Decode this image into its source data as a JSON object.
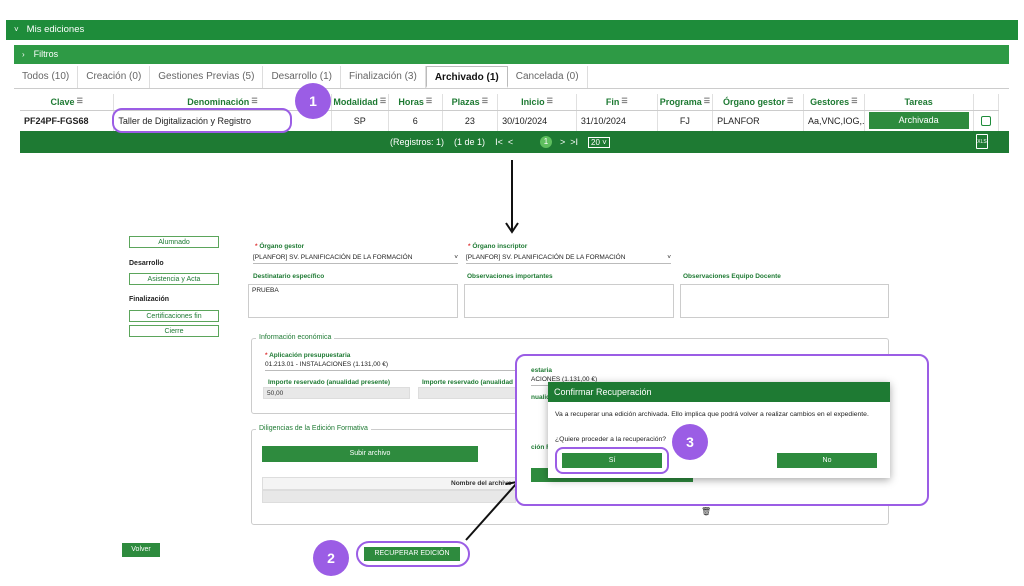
{
  "header": {
    "title": "Mis ediciones",
    "filters_label": "Filtros"
  },
  "tabs": [
    {
      "label": "Todos (10)"
    },
    {
      "label": "Creación (0)"
    },
    {
      "label": "Gestiones Previas (5)"
    },
    {
      "label": "Desarrollo (1)"
    },
    {
      "label": "Finalización (3)"
    },
    {
      "label": "Archivado (1)"
    },
    {
      "label": "Cancelada (0)"
    }
  ],
  "table": {
    "columns": [
      "Clave",
      "Denominación",
      "Modalidad",
      "Horas",
      "Plazas",
      "Inicio",
      "Fin",
      "Programa",
      "Órgano gestor",
      "Gestores",
      "Tareas"
    ],
    "row": {
      "clave": "PF24PF-FGS68",
      "denominacion": "Taller de Digitalización y Registro",
      "modalidad": "SP",
      "horas": "6",
      "plazas": "23",
      "inicio": "30/10/2024",
      "fin": "31/10/2024",
      "programa": "FJ",
      "organo": "PLANFOR",
      "gestores": "Aa,VNC,IOG,...",
      "tarea": "Archivada"
    }
  },
  "pager": {
    "info": "(Registros: 1)",
    "pages": "(1 de 1)",
    "current": "1",
    "size": "20"
  },
  "annotations": {
    "step1": "1",
    "step2": "2",
    "step3": "3"
  },
  "form": {
    "sidebar": {
      "alumnado": "Alumnado",
      "desarrollo_head": "Desarrollo",
      "asistencia": "Asistencia y Acta",
      "finalizacion_head": "Finalización",
      "certificaciones": "Certificaciones fin",
      "cierre": "Cierre"
    },
    "organo_gestor_label": "Órgano gestor",
    "organo_gestor_value": "[PLANFOR] SV. PLANIFICACIÓN DE LA FORMACIÓN",
    "organo_inscriptor_label": "Órgano inscriptor",
    "organo_inscriptor_value": "[PLANFOR] SV. PLANIFICACIÓN DE LA FORMACIÓN",
    "destinatario_label": "Destinatario específico",
    "destinatario_value": "PRUEBA",
    "observaciones_label": "Observaciones importantes",
    "observaciones_equipo_label": "Observaciones Equipo Docente",
    "info_economica_legend": "Información económica",
    "aplicacion_label": "Aplicación presupuestaria",
    "aplicacion_value": "01.213.01 - INSTALACIONES (1.131,00 €)",
    "importe_presente_label": "Importe reservado (anualidad presente)",
    "importe_presente_value": "50,00",
    "importe_futura_label": "Importe reservado (anualidad futur",
    "right_label_1": "estaria",
    "right_value_1": "ACIONES (1.131,00 €)",
    "right_label_2": "nualid",
    "diligencias_legend": "Diligencias de la Edición Formativa",
    "subir_archivo": "Subir archivo",
    "nombre_archivo_header": "Nombre del archivo",
    "right_label_3": "ción F",
    "volver": "Volver",
    "recuperar": "RECUPERAR EDICIÓN"
  },
  "modal": {
    "title": "Confirmar Recuperación",
    "message": "Va a recuperar una edición archivada. Ello implica que podrá volver a realizar cambios en el expediente.",
    "question": "¿Quiere proceder a la recuperación?",
    "yes": "Sí",
    "no": "No"
  },
  "colors": {
    "primary_green": "#1e8c3a",
    "annotation_purple": "#9b5de5"
  }
}
